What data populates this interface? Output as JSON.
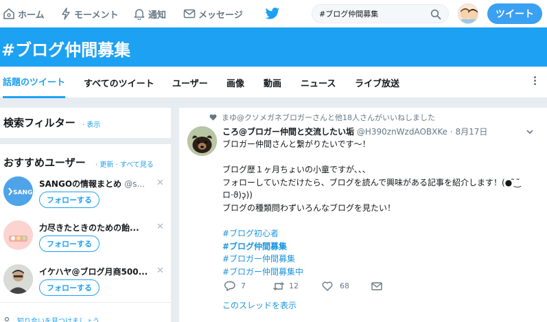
{
  "nav": {
    "home": "ホーム",
    "moments": "モーメント",
    "notifications": "通知",
    "messages": "メッセージ"
  },
  "search": {
    "value": "#ブログ仲間募集"
  },
  "tweet_button": "ツイート",
  "banner": {
    "title": "#ブログ仲間募集"
  },
  "tabs": [
    "話題のツイート",
    "すべてのツイート",
    "ユーザー",
    "画像",
    "動画",
    "ニュース",
    "ライブ放送"
  ],
  "sidebar": {
    "filter_title": "検索フィルター",
    "filter_link": "· 表示",
    "rec_title": "おすすめユーザー",
    "rec_links": "· 更新 · すべて見る",
    "users": [
      {
        "name": "SANGOの情報まとめ",
        "handle": "@s...",
        "follow": "フォローする",
        "avatar_text": "SANGO"
      },
      {
        "name": "力尽きたときのための飴...",
        "handle": "",
        "follow": "フォローする",
        "avatar_text": ""
      },
      {
        "name": "イケハヤ@ブログ月商500...",
        "handle": "",
        "follow": "フォローする",
        "avatar_text": ""
      }
    ],
    "bottom_link": "知り合いを見つけましょう"
  },
  "tweet": {
    "liked_by": "まゆ@クソメガネブロガーさんと他18人さんがいいねしました",
    "name": "ころ@ブロガー仲間と交流したい垢",
    "handle": "@H390znWzdAOBXKe",
    "date": "· 8月17日",
    "lines": [
      "ブロガー仲間さんと繋がりたいです～！",
      "",
      "ブログ歴１ヶ月ちょいの小童ですが、、、",
      "フォローしていただけたら、ブログを読んで興味がある記事を紹介します！(● ̃ ͜ ̃",
      "ロ·ϑ)ɔ͎))",
      "ブログの種類問わずいろんなブログを見たい！",
      ""
    ],
    "hashtags": [
      {
        "text": "#ブログ初心者",
        "bold": false
      },
      {
        "text": "#ブログ仲間募集",
        "bold": true
      },
      {
        "text": "#ブロガー仲間募集",
        "bold": false
      },
      {
        "text": "#ブロガー仲間募集中",
        "bold": false
      }
    ],
    "replies": "7",
    "retweets": "12",
    "likes": "68",
    "thread_link": "このスレッドを表示"
  },
  "colors": {
    "accent": "#1da1f2",
    "background": "#e6ecf0"
  }
}
